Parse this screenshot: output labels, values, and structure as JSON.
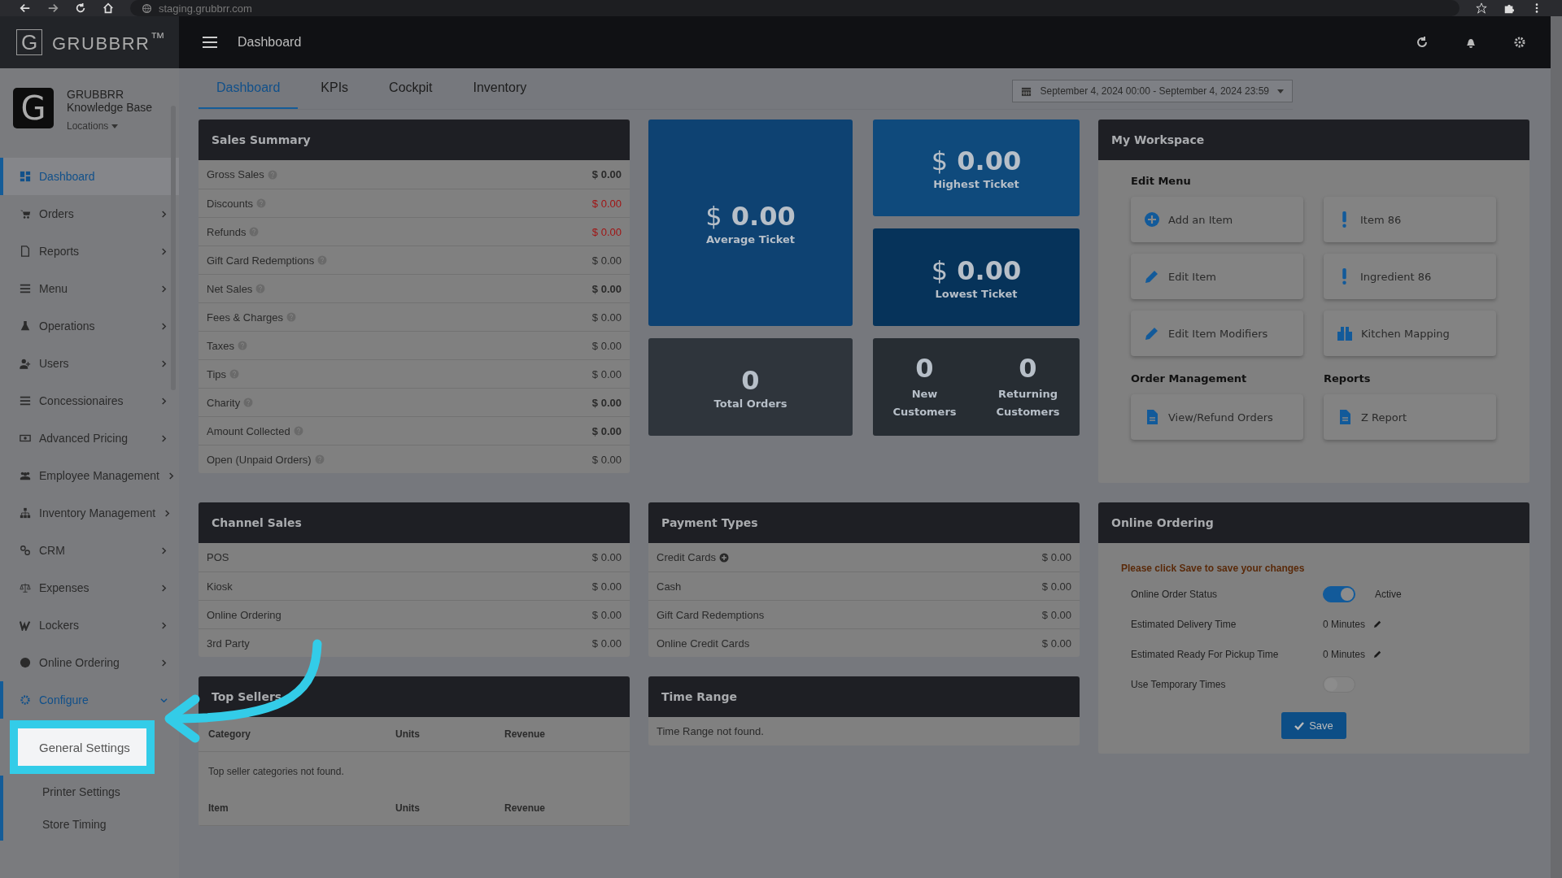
{
  "browser": {
    "url": "staging.grubbrr.com"
  },
  "topbar": {
    "logo_letter": "G",
    "brand": "GRUBBRR$^{™}$",
    "page_title": "Dashboard"
  },
  "account": {
    "logo_letter": "G",
    "name": "GRUBBRR",
    "subtitle": "Knowledge Base",
    "locations": "Locations"
  },
  "sidebar": {
    "items": [
      {
        "label": "Dashboard",
        "selected": true,
        "expanded": false,
        "submenu": false
      },
      {
        "label": "Orders",
        "selected": false,
        "expanded": false,
        "submenu": true
      },
      {
        "label": "Reports",
        "selected": false,
        "expanded": false,
        "submenu": true
      },
      {
        "label": "Menu",
        "selected": false,
        "expanded": false,
        "submenu": true
      },
      {
        "label": "Operations",
        "selected": false,
        "expanded": false,
        "submenu": true
      },
      {
        "label": "Users",
        "selected": false,
        "expanded": false,
        "submenu": true
      },
      {
        "label": "Concessionaires",
        "selected": false,
        "expanded": false,
        "submenu": true
      },
      {
        "label": "Advanced Pricing",
        "selected": false,
        "expanded": false,
        "submenu": true
      },
      {
        "label": "Employee Management",
        "selected": false,
        "expanded": false,
        "submenu": true
      },
      {
        "label": "Inventory Management",
        "selected": false,
        "expanded": false,
        "submenu": true
      },
      {
        "label": "CRM",
        "selected": false,
        "expanded": false,
        "submenu": true
      },
      {
        "label": "Expenses",
        "selected": false,
        "expanded": false,
        "submenu": true
      },
      {
        "label": "Lockers",
        "selected": false,
        "expanded": false,
        "submenu": true
      },
      {
        "label": "Online Ordering",
        "selected": false,
        "expanded": false,
        "submenu": true
      },
      {
        "label": "Configure",
        "selected": false,
        "expanded": true,
        "submenu": true,
        "children": [
          {
            "label": "General Settings",
            "highlighted": true
          },
          {
            "label": "Printer Settings",
            "highlighted": false
          },
          {
            "label": "Store Timing",
            "highlighted": false
          }
        ]
      }
    ]
  },
  "tabs": [
    {
      "label": "Dashboard",
      "selected": true
    },
    {
      "label": "KPIs",
      "selected": false
    },
    {
      "label": "Cockpit",
      "selected": false
    },
    {
      "label": "Inventory",
      "selected": false
    }
  ],
  "date_range": "September 4, 2024 00:00 - September 4, 2024 23:59",
  "sales_summary": {
    "title": "Sales Summary",
    "rows": [
      {
        "label": "Gross Sales",
        "value": "$ 0.00",
        "bold": true,
        "negative": false
      },
      {
        "label": "Discounts",
        "value": "$ 0.00",
        "bold": false,
        "negative": true
      },
      {
        "label": "Refunds",
        "value": "$ 0.00",
        "bold": false,
        "negative": true
      },
      {
        "label": "Gift Card Redemptions",
        "value": "$ 0.00",
        "bold": false,
        "negative": false
      },
      {
        "label": "Net Sales",
        "value": "$ 0.00",
        "bold": true,
        "negative": false
      },
      {
        "label": "Fees & Charges",
        "value": "$ 0.00",
        "bold": false,
        "negative": false
      },
      {
        "label": "Taxes",
        "value": "$ 0.00",
        "bold": false,
        "negative": false
      },
      {
        "label": "Tips",
        "value": "$ 0.00",
        "bold": false,
        "negative": false
      },
      {
        "label": "Charity",
        "value": "$ 0.00",
        "bold": true,
        "negative": false
      },
      {
        "label": "Amount Collected",
        "value": "$ 0.00",
        "bold": true,
        "negative": false
      },
      {
        "label": "Open (Unpaid Orders)",
        "value": "$ 0.00",
        "bold": false,
        "negative": false
      }
    ]
  },
  "average_ticket": {
    "currency": "$",
    "value": "0.00",
    "label": "Average Ticket"
  },
  "highest_ticket": {
    "currency": "$",
    "value": "0.00",
    "label": "Highest Ticket"
  },
  "lowest_ticket": {
    "currency": "$",
    "value": "0.00",
    "label": "Lowest Ticket"
  },
  "total_orders": {
    "value": "0",
    "label": "Total Orders"
  },
  "customers": [
    {
      "value": "0",
      "label": "New Customers"
    },
    {
      "value": "0",
      "label": "Returning Customers"
    }
  ],
  "workspace": {
    "title": "My Workspace",
    "edit_menu": {
      "title": "Edit Menu",
      "buttons": [
        "Add an Item",
        "Item 86",
        "Edit Item",
        "Ingredient 86",
        "Edit Item Modifiers",
        "Kitchen Mapping"
      ]
    },
    "order_management": {
      "title": "Order Management",
      "buttons": [
        "View/Refund Orders"
      ]
    },
    "reports": {
      "title": "Reports",
      "buttons": [
        "Z Report"
      ]
    }
  },
  "channel_sales": {
    "title": "Channel Sales",
    "rows": [
      {
        "label": "POS",
        "value": "$ 0.00"
      },
      {
        "label": "Kiosk",
        "value": "$ 0.00"
      },
      {
        "label": "Online Ordering",
        "value": "$ 0.00"
      },
      {
        "label": "3rd Party",
        "value": "$ 0.00"
      }
    ]
  },
  "payment_types": {
    "title": "Payment Types",
    "rows": [
      {
        "label": "Credit Cards",
        "value": "$ 0.00",
        "expandable": true
      },
      {
        "label": "Cash",
        "value": "$ 0.00",
        "expandable": false
      },
      {
        "label": "Gift Card Redemptions",
        "value": "$ 0.00",
        "expandable": false
      },
      {
        "label": "Online Credit Cards",
        "value": "$ 0.00",
        "expandable": false
      }
    ]
  },
  "top_sellers": {
    "title": "Top Sellers",
    "category_columns": [
      "Category",
      "Units",
      "Revenue"
    ],
    "empty": "Top seller categories not found.",
    "item_columns": [
      "Item",
      "Units",
      "Revenue"
    ]
  },
  "time_range": {
    "title": "Time Range",
    "empty": "Time Range not found."
  },
  "online_ordering": {
    "title": "Online Ordering",
    "notice": "Please click Save to save your changes",
    "rows": [
      {
        "kind": "toggle",
        "label": "Online Order Status",
        "on": true,
        "status": "Active"
      },
      {
        "kind": "time",
        "label": "Estimated Delivery Time",
        "value": "0 Minutes"
      },
      {
        "kind": "time",
        "label": "Estimated Ready For Pickup Time",
        "value": "0 Minutes"
      },
      {
        "kind": "toggle",
        "label": "Use Temporary Times",
        "on": false
      }
    ],
    "save": "Save"
  }
}
